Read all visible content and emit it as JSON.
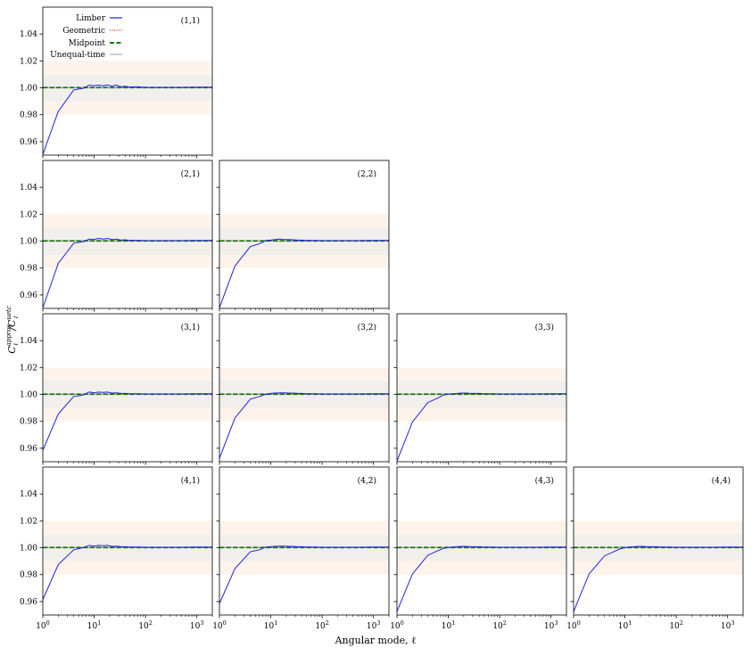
{
  "figure": {
    "xlabel": "Angular mode, ℓ",
    "ylabel_main": "C",
    "ylabel_sub": "ℓ",
    "ylabel_sup": "approx",
    "ylabel_sep": "/C",
    "ylabel_sup2": "uetc"
  },
  "legend": {
    "items": [
      {
        "label": "Limber",
        "color": "#1f1fe0",
        "style": "solid"
      },
      {
        "label": "Geometric",
        "color": "#c8281e",
        "style": "dotted"
      },
      {
        "label": "Midpoint",
        "color": "#117a11",
        "style": "dashed"
      },
      {
        "label": "Unequal-time",
        "color": "#aaaaaa",
        "style": "solid"
      }
    ]
  },
  "colors": {
    "band_outer": "#fdf3ea",
    "band_inner": "#f1efec",
    "axes": "#000000"
  },
  "chart_data": {
    "type": "line",
    "layout": "lower-triangular 4x4 grid, shared x and y axes",
    "xscale": "log",
    "xlim": [
      1,
      2000
    ],
    "ylim": [
      0.95,
      1.06
    ],
    "xticks": [
      1,
      10,
      100,
      1000
    ],
    "xtick_labels": [
      "10^0",
      "10^1",
      "10^2",
      "10^3"
    ],
    "yticks": [
      0.96,
      0.98,
      1.0,
      1.02,
      1.04
    ],
    "ytick_labels": [
      "0.96",
      "0.98",
      "1.00",
      "1.02",
      "1.04"
    ],
    "bands": [
      {
        "y_range": [
          0.98,
          1.02
        ],
        "color": "#fdf3ea"
      },
      {
        "y_range": [
          0.99,
          1.01
        ],
        "color": "#f1efec"
      }
    ],
    "ell": [
      1,
      2,
      4,
      6,
      8,
      10,
      12,
      15,
      18,
      22,
      27,
      33,
      40,
      50,
      70,
      100,
      200,
      500,
      1000,
      2000
    ],
    "panels": [
      {
        "label": "(1,1)",
        "row": 1,
        "col": 1,
        "limber": [
          0.9505,
          0.9825,
          0.9985,
          0.9995,
          1.002,
          1.0015,
          1.002,
          1.0015,
          1.0022,
          1.0012,
          1.002,
          1.0008,
          1.0012,
          1.0005,
          1.0008,
          1.0004,
          1.0004,
          1.0004,
          1.0005,
          1.0005
        ],
        "others": 1.0002
      },
      {
        "label": "(2,1)",
        "row": 2,
        "col": 1,
        "limber": [
          0.9505,
          0.9835,
          0.9985,
          0.9995,
          1.0015,
          1.0012,
          1.002,
          1.0015,
          1.002,
          1.0012,
          1.0015,
          1.0008,
          1.001,
          1.0005,
          1.0006,
          1.0004,
          1.0004,
          1.0004,
          1.0005,
          1.0005
        ],
        "others": 1.0002
      },
      {
        "label": "(2,2)",
        "row": 2,
        "col": 2,
        "limber": [
          0.9505,
          0.9815,
          0.996,
          0.998,
          1.0005,
          1.0008,
          1.0012,
          1.0015,
          1.0012,
          1.0012,
          1.001,
          1.0008,
          1.0008,
          1.0005,
          1.0005,
          1.0004,
          1.0004,
          1.0004,
          1.0005,
          1.0005
        ],
        "others": 1.0002
      },
      {
        "label": "(3,1)",
        "row": 3,
        "col": 1,
        "limber": [
          0.9585,
          0.9855,
          0.9985,
          0.9995,
          1.0018,
          1.0012,
          1.0018,
          1.0015,
          1.0018,
          1.001,
          1.0012,
          1.0008,
          1.0008,
          1.0005,
          1.0005,
          1.0004,
          1.0004,
          1.0004,
          1.0005,
          1.0005
        ],
        "others": 1.0002
      },
      {
        "label": "(3,2)",
        "row": 3,
        "col": 2,
        "limber": [
          0.9525,
          0.9825,
          0.9965,
          0.9985,
          1.0002,
          1.0008,
          1.001,
          1.0012,
          1.0012,
          1.001,
          1.001,
          1.0008,
          1.0008,
          1.0005,
          1.0005,
          1.0004,
          1.0004,
          1.0004,
          1.0005,
          1.0005
        ],
        "others": 1.0002
      },
      {
        "label": "(3,3)",
        "row": 3,
        "col": 3,
        "limber": [
          0.9505,
          0.9795,
          0.994,
          0.997,
          0.9995,
          1.0002,
          1.0005,
          1.0008,
          1.001,
          1.001,
          1.0008,
          1.0008,
          1.0008,
          1.0005,
          1.0005,
          1.0004,
          1.0004,
          1.0004,
          1.0005,
          1.0005
        ],
        "others": 1.0002
      },
      {
        "label": "(4,1)",
        "row": 4,
        "col": 1,
        "limber": [
          0.9615,
          0.9875,
          0.9985,
          1.0,
          1.0018,
          1.0012,
          1.0018,
          1.0015,
          1.0018,
          1.001,
          1.0012,
          1.0008,
          1.0008,
          1.0005,
          1.0005,
          1.0004,
          1.0004,
          1.0004,
          1.0005,
          1.0005
        ],
        "others": 1.0002
      },
      {
        "label": "(4,2)",
        "row": 4,
        "col": 2,
        "limber": [
          0.9585,
          0.9845,
          0.997,
          0.9985,
          1.0005,
          1.0008,
          1.001,
          1.0012,
          1.0012,
          1.001,
          1.001,
          1.0008,
          1.0008,
          1.0005,
          1.0005,
          1.0004,
          1.0004,
          1.0004,
          1.0005,
          1.0005
        ],
        "others": 1.0002
      },
      {
        "label": "(4,3)",
        "row": 4,
        "col": 3,
        "limber": [
          0.9525,
          0.9805,
          0.9945,
          0.9975,
          0.9995,
          1.0002,
          1.0005,
          1.0008,
          1.001,
          1.001,
          1.0008,
          1.0008,
          1.0008,
          1.0005,
          1.0005,
          1.0004,
          1.0004,
          1.0004,
          1.0005,
          1.0005
        ],
        "others": 1.0002
      },
      {
        "label": "(4,4)",
        "row": 4,
        "col": 4,
        "limber": [
          0.9525,
          0.9805,
          0.994,
          0.997,
          0.9992,
          1.0,
          1.0005,
          1.0008,
          1.001,
          1.001,
          1.0008,
          1.0008,
          1.0008,
          1.0005,
          1.0005,
          1.0004,
          1.0004,
          1.0004,
          1.0005,
          1.0005
        ],
        "others": 1.0002
      }
    ]
  }
}
